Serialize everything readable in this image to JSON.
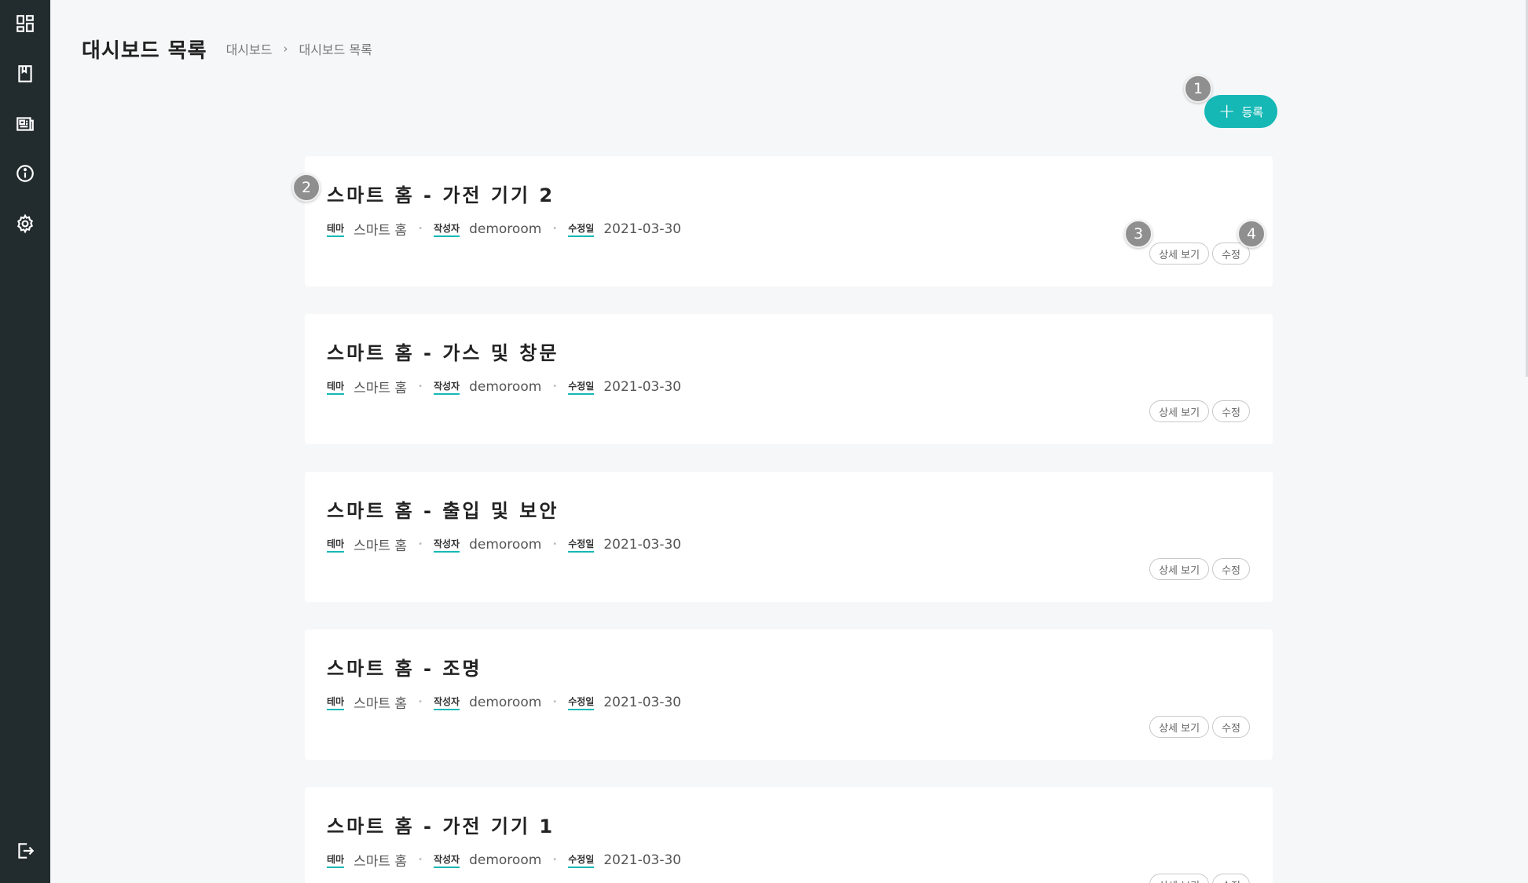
{
  "sidebar": {
    "icons": [
      "dashboard-grid-icon",
      "book-icon",
      "newspaper-icon",
      "info-icon",
      "gear-icon",
      "logout-icon"
    ]
  },
  "header": {
    "title": "대시보드 목록",
    "breadcrumb": [
      "대시보드",
      "대시보드 목록"
    ]
  },
  "toolbar": {
    "add_label": "등록"
  },
  "badges": [
    "1",
    "2",
    "3",
    "4"
  ],
  "meta_labels": {
    "theme": "테마",
    "author": "작성자",
    "modified": "수정일"
  },
  "actions": {
    "detail": "상세 보기",
    "edit": "수정"
  },
  "cards": [
    {
      "title": "스마트 홈 - 가전 기기 2",
      "theme": "스마트 홈",
      "author": "demoroom",
      "modified": "2021-03-30"
    },
    {
      "title": "스마트 홈 - 가스 및 창문",
      "theme": "스마트 홈",
      "author": "demoroom",
      "modified": "2021-03-30"
    },
    {
      "title": "스마트 홈 - 출입 및 보안",
      "theme": "스마트 홈",
      "author": "demoroom",
      "modified": "2021-03-30"
    },
    {
      "title": "스마트 홈 - 조명",
      "theme": "스마트 홈",
      "author": "demoroom",
      "modified": "2021-03-30"
    },
    {
      "title": "스마트 홈 - 가전 기기 1",
      "theme": "스마트 홈",
      "author": "demoroom",
      "modified": "2021-03-30"
    }
  ],
  "colors": {
    "accent": "#15b8b5",
    "sidebar": "#222b2d",
    "background": "#f6f7f8",
    "badge": "#8f8f8f"
  }
}
